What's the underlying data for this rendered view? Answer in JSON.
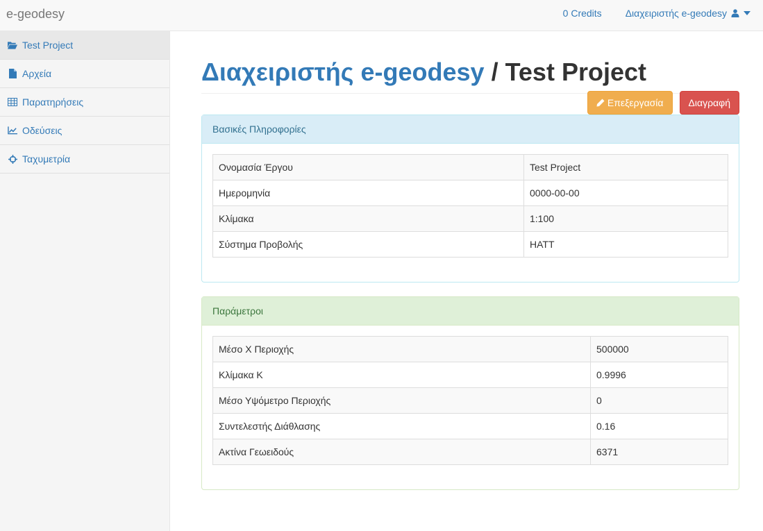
{
  "navbar": {
    "brand": "e-geodesy",
    "credits": "0 Credits",
    "user": "Διαχειριστής e-geodesy"
  },
  "sidebar": {
    "items": [
      {
        "label": "Test Project",
        "icon": "folder-open-icon"
      },
      {
        "label": "Αρχεία",
        "icon": "file-icon"
      },
      {
        "label": "Παρατηρήσεις",
        "icon": "table-icon"
      },
      {
        "label": "Οδεύσεις",
        "icon": "line-chart-icon"
      },
      {
        "label": "Ταχυμετρία",
        "icon": "crosshair-icon"
      }
    ]
  },
  "header": {
    "owner": "Διαχειριστής e-geodesy",
    "separator": " / ",
    "project": "Test Project"
  },
  "actions": {
    "edit_label": "Επεξεργασία",
    "delete_label": "Διαγραφή"
  },
  "basic_info": {
    "title": "Βασικές Πληροφορίες",
    "rows": [
      {
        "label": "Ονομασία Έργου",
        "value": "Test Project"
      },
      {
        "label": "Ημερομηνία",
        "value": "0000-00-00"
      },
      {
        "label": "Κλίμακα",
        "value": "1:100"
      },
      {
        "label": "Σύστημα Προβολής",
        "value": "HATT"
      }
    ]
  },
  "parameters": {
    "title": "Παράμετροι",
    "rows": [
      {
        "label": "Μέσο Χ Περιοχής",
        "value": "500000"
      },
      {
        "label": "Κλίμακα Κ",
        "value": "0.9996"
      },
      {
        "label": "Μέσο Υψόμετρο Περιοχής",
        "value": "0"
      },
      {
        "label": "Συντελεστής Διάθλασης",
        "value": "0.16"
      },
      {
        "label": "Ακτίνα Γεωειδούς",
        "value": "6371"
      }
    ]
  },
  "colors": {
    "link": "#337ab7",
    "warning": "#f0ad4e",
    "danger": "#d9534f",
    "info_bg": "#d9edf7",
    "success_bg": "#dff0d8"
  }
}
